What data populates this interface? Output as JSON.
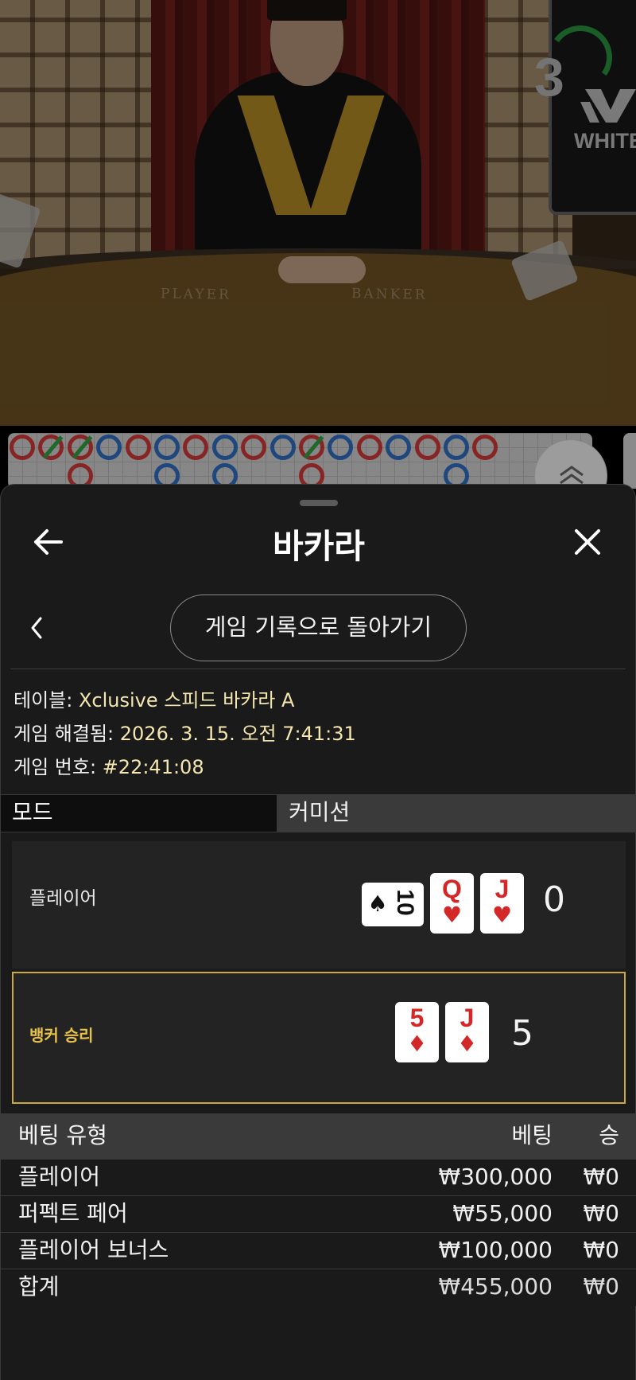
{
  "video": {
    "countdown": "3",
    "brand": "WHITE",
    "felt_left": "PLAYER",
    "felt_right": "BANKER"
  },
  "road": {
    "top_row": [
      "B",
      "B",
      "B",
      "P",
      "B",
      "P",
      "B",
      "P",
      "B",
      "P",
      "B",
      "P",
      "B",
      "P",
      "B",
      "P",
      "B"
    ],
    "colors": {
      "banker": "#d03a3a",
      "player": "#2f6ec2",
      "tie": "#2ea043"
    }
  },
  "header": {
    "title": "바카라",
    "back_icon": "arrow-left-icon",
    "close_icon": "close-icon"
  },
  "history_button": "게임 기록으로 돌아가기",
  "info": {
    "table_label": "테이블:",
    "table_value": "Xclusive 스피드 바카라 A",
    "resolved_label": "게임 해결됨:",
    "resolved_value": "2026. 3. 15. 오전 7:41:31",
    "number_label": "게임 번호:",
    "number_value": "#22:41:08"
  },
  "tabs": {
    "mode": "모드",
    "commission": "커미션"
  },
  "player": {
    "name": "플레이어",
    "score": "0",
    "cards": [
      {
        "rank": "10",
        "suit": "♠",
        "sideways": true
      },
      {
        "rank": "Q",
        "suit": "♥"
      },
      {
        "rank": "J",
        "suit": "♥"
      }
    ]
  },
  "banker": {
    "name": "뱅커 승리",
    "score": "5",
    "cards": [
      {
        "rank": "5",
        "suit": "♦"
      },
      {
        "rank": "J",
        "suit": "♦"
      }
    ],
    "highlight_color": "#c9a93a"
  },
  "bets": {
    "headers": {
      "type": "베팅 유형",
      "bet": "베팅",
      "win": "승"
    },
    "rows": [
      {
        "type": "플레이어",
        "bet": "₩300,000",
        "win": "₩0"
      },
      {
        "type": "퍼펙트 페어",
        "bet": "₩55,000",
        "win": "₩0"
      },
      {
        "type": "플레이어 보너스",
        "bet": "₩100,000",
        "win": "₩0"
      }
    ],
    "total": {
      "type": "합계",
      "bet": "₩455,000",
      "win": "₩0"
    }
  }
}
